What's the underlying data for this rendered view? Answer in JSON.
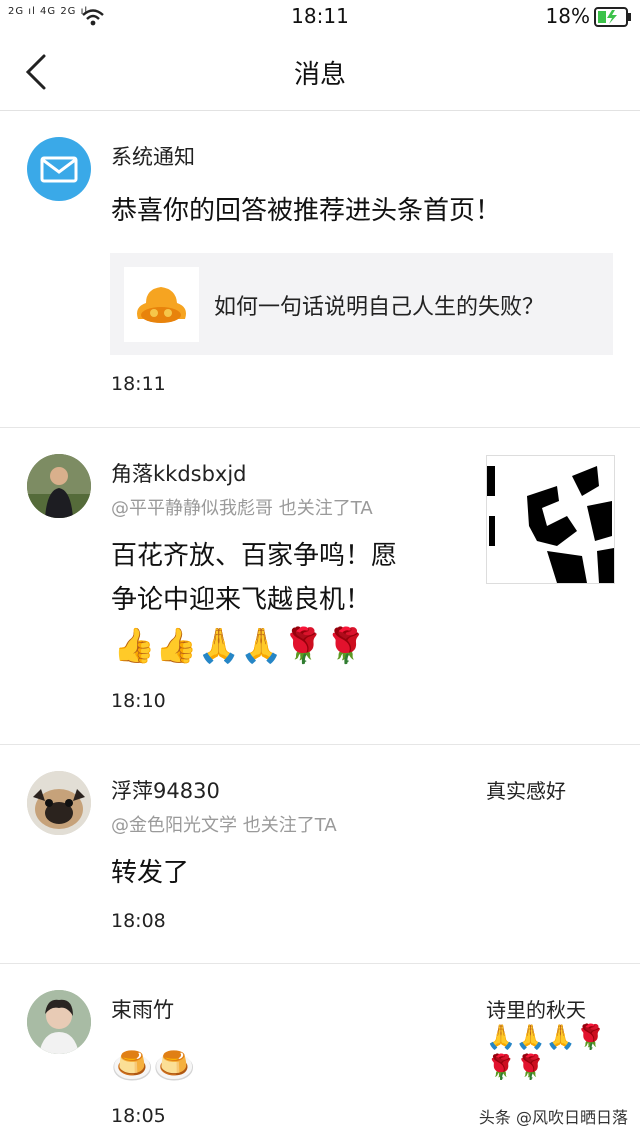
{
  "status_bar": {
    "signal_left": "2G ıl 4G 2G ıl",
    "time": "18:11",
    "battery": "18%"
  },
  "header": {
    "title": "消息"
  },
  "messages": [
    {
      "name": "系统通知",
      "body": "恭喜你的回答被推荐进头条首页！",
      "card_text": "如何一句话说明自己人生的失败？",
      "time": "18:11"
    },
    {
      "name": "角落kkdsbxjd",
      "sub": "@平平静静似我彪哥 也关注了TA",
      "body_line1": "百花齐放、百家争鸣！愿",
      "body_line2": "争论中迎来飞越良机！",
      "emoji": "👍👍🙏🙏🌹🌹",
      "time": "18:10"
    },
    {
      "name": "浮萍94830",
      "sub": "@金色阳光文学 也关注了TA",
      "body": "转发了",
      "side_text": "真实感好",
      "time": "18:08"
    },
    {
      "name": "束雨竹",
      "emoji": "🍮🍮",
      "side_text": "诗里的秋天",
      "side_emoji_line1": "🙏🙏🙏🌹",
      "side_emoji_line2": "🌹🌹",
      "time": "18:05"
    }
  ],
  "watermark": "头条 @风吹日晒日落"
}
